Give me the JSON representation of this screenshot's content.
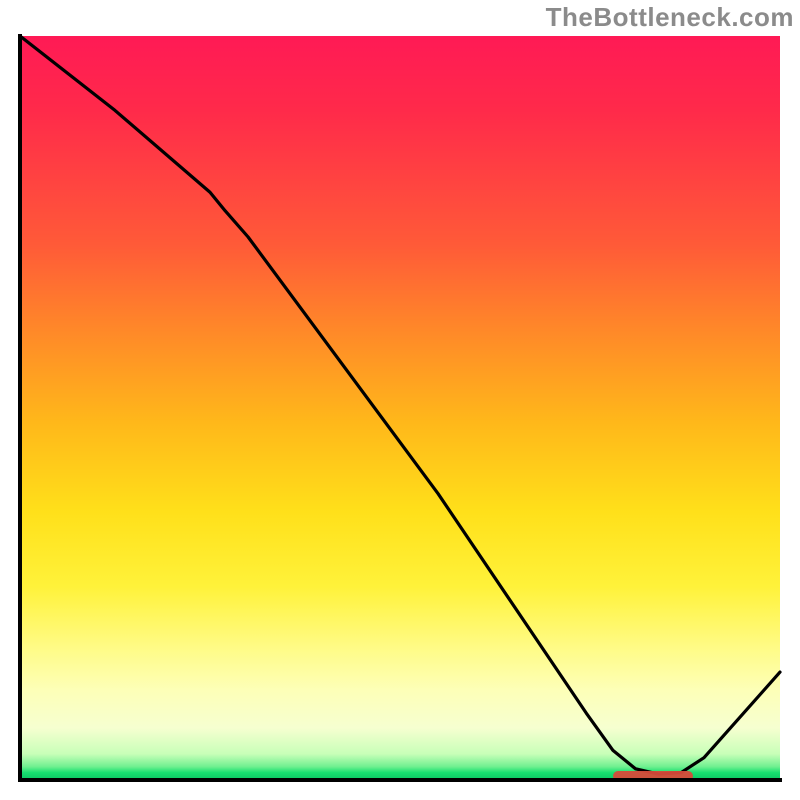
{
  "watermark": "TheBottleneck.com",
  "chart_data": {
    "type": "line",
    "title": "",
    "xlabel": "",
    "ylabel": "",
    "xlim": [
      0,
      100
    ],
    "ylim": [
      0,
      100
    ],
    "grid": false,
    "legend": false,
    "background_gradient": {
      "orientation": "vertical",
      "stops": [
        {
          "pos": 0.0,
          "color": "#ff1a55"
        },
        {
          "pos": 0.28,
          "color": "#ff5a38"
        },
        {
          "pos": 0.52,
          "color": "#ffb81a"
        },
        {
          "pos": 0.74,
          "color": "#fff23a"
        },
        {
          "pos": 0.93,
          "color": "#f6ffd0"
        },
        {
          "pos": 0.99,
          "color": "#18e070"
        },
        {
          "pos": 1.0,
          "color": "#0ec862"
        }
      ]
    },
    "series": [
      {
        "name": "bottleneck-curve",
        "color": "#000000",
        "x": [
          0.0,
          12.5,
          25.0,
          27.0,
          30.0,
          55.0,
          74.5,
          78.0,
          81.0,
          84.0,
          87.0,
          90.0,
          100.0
        ],
        "y": [
          100.0,
          90.0,
          79.0,
          76.5,
          73.0,
          38.5,
          9.0,
          4.0,
          1.5,
          0.8,
          1.0,
          3.0,
          14.5
        ]
      }
    ],
    "optimal_marker": {
      "x_start": 78.0,
      "x_end": 88.5,
      "y": 0.6,
      "color": "#d64a3a",
      "label": ""
    }
  }
}
